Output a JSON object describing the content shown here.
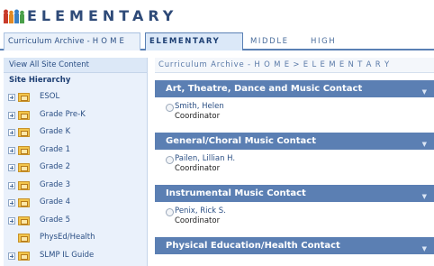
{
  "site": {
    "title": "ELEMENTARY"
  },
  "tabs": [
    {
      "label": "Curriculum Archive - H O M E"
    },
    {
      "label": "ELEMENTARY"
    },
    {
      "label": "MIDDLE"
    },
    {
      "label": "HIGH"
    }
  ],
  "leftnav": {
    "view_all": "View All Site Content",
    "hierarchy": "Site Hierarchy",
    "items": [
      {
        "label": "ESOL"
      },
      {
        "label": "Grade Pre-K"
      },
      {
        "label": "Grade K"
      },
      {
        "label": "Grade 1"
      },
      {
        "label": "Grade 2"
      },
      {
        "label": "Grade 3"
      },
      {
        "label": "Grade 4"
      },
      {
        "label": "Grade 5"
      },
      {
        "label": "PhysEd/Health"
      },
      {
        "label": "SLMP IL Guide"
      }
    ]
  },
  "main": {
    "breadcrumb": "Curriculum Archive - H O M E > E L E M E N T A R Y",
    "sections": [
      {
        "title": "Art, Theatre, Dance and Music Contact",
        "name": "Smith, Helen",
        "role": "Coordinator"
      },
      {
        "title": "General/Choral Music Contact",
        "name": "Pailen, Lillian H.",
        "role": "Coordinator"
      },
      {
        "title": "Instrumental Music Contact",
        "name": "Penix, Rick S.",
        "role": "Coordinator"
      },
      {
        "title": "Physical Education/Health Contact"
      }
    ]
  },
  "colors": {
    "accent": "#5b7fb3",
    "title": "#2e4a78",
    "link": "#2b4f84",
    "nav_bg": "#eaf1fb"
  },
  "icons": {
    "logo": "people-logo-icon",
    "folder": "folder-icon",
    "expander": "plus-expander-icon",
    "chevron": "chevron-down-icon",
    "radio": "presence-radio-icon"
  }
}
